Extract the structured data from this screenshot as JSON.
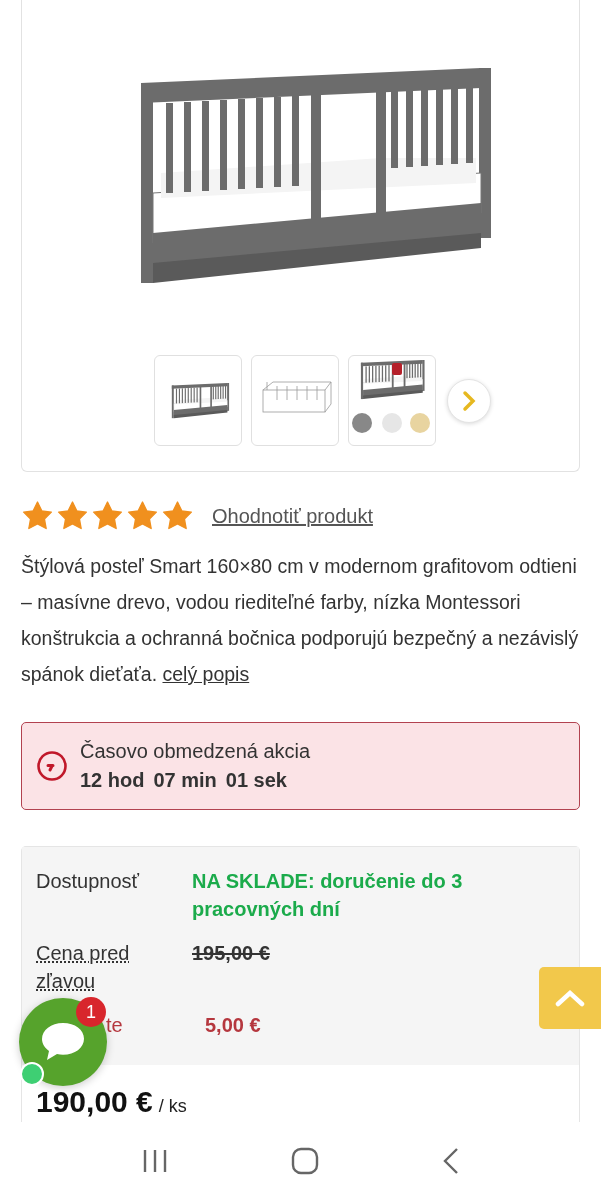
{
  "gallery": {
    "thumbnails": [
      {
        "kind": "photo",
        "selected": false
      },
      {
        "kind": "sketch",
        "selected": false
      },
      {
        "kind": "detail",
        "selected": false
      }
    ]
  },
  "rating": {
    "stars": 5,
    "link": "Ohodnotiť produkt"
  },
  "description": {
    "text": "Štýlová posteľ Smart 160×80 cm v modernom grafitovom odtieni – masívne drevo, vodou riediteľné farby, nízka Montessori konštrukcia a ochranná bočnica podporujú bezpečný a nezávislý spánok dieťaťa.",
    "link": "celý popis"
  },
  "promo": {
    "title": "Časovo obmedzená akcia",
    "countdown": [
      "12 hod",
      "07 min",
      "01 sek"
    ]
  },
  "info": {
    "rows": [
      {
        "kind": "availability",
        "label": "Dostupnosť",
        "value": "NA SKLADE: doručenie do 3 pracovných dní"
      },
      {
        "kind": "old_price",
        "label": "Cena pred zľavou",
        "value": "195,00 €"
      },
      {
        "kind": "saving",
        "label": "te",
        "value": "5,00 €"
      }
    ],
    "price": "190,00 €",
    "unit": "/ ks"
  },
  "chat": {
    "badge": "1",
    "online": true
  }
}
